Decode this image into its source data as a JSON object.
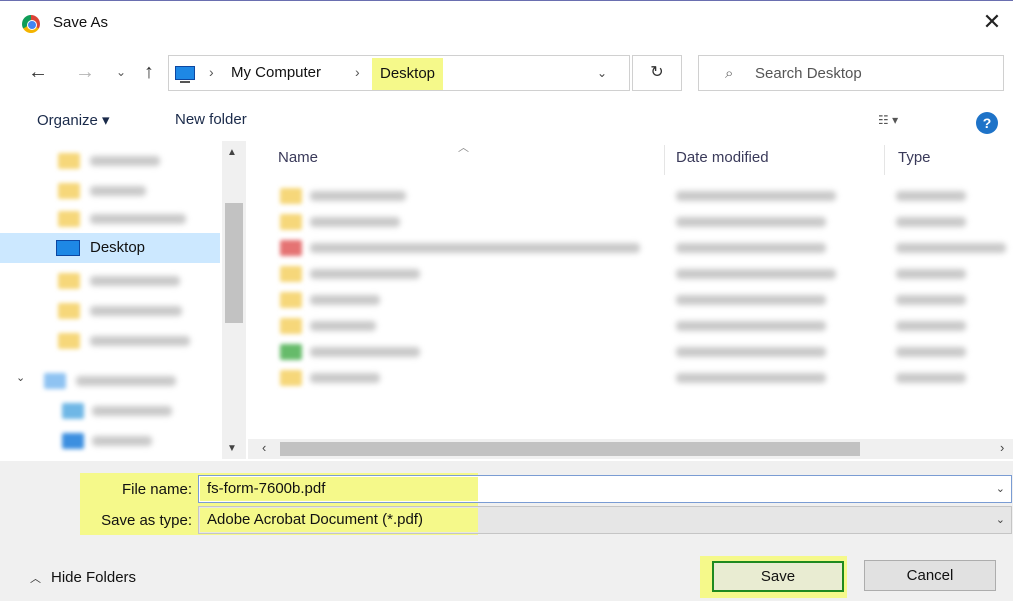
{
  "window": {
    "title": "Save As",
    "close_glyph": "✕"
  },
  "nav": {
    "back_glyph": "←",
    "forward_glyph": "→",
    "recent_glyph": "⌄",
    "up_glyph": "↑",
    "breadcrumb": [
      "My Computer",
      "Desktop"
    ],
    "separator": "›",
    "dropdown_glyph": "⌄",
    "refresh_glyph": "↻",
    "search_placeholder": "Search Desktop",
    "search_glyph": "⌕"
  },
  "toolbar": {
    "organize_label": "Organize ▾",
    "new_folder_label": "New folder",
    "view_glyph": "☷ ▾",
    "help_glyph": "?"
  },
  "nav_pane": {
    "selected_label": "Desktop",
    "expand_glyph": "⌄"
  },
  "file_list": {
    "columns": [
      "Name",
      "Date modified",
      "Type"
    ],
    "sort_glyph": "︿"
  },
  "scroll": {
    "up_glyph": "▲",
    "down_glyph": "▼",
    "left_glyph": "‹",
    "right_glyph": "›"
  },
  "form": {
    "file_name_label": "File name:",
    "file_name_value": "fs-form-7600b.pdf",
    "save_type_label": "Save as type:",
    "save_type_value": "Adobe Acrobat Document (*.pdf)",
    "caret_glyph": "⌄"
  },
  "footer": {
    "hide_folders_label": "Hide Folders",
    "hide_caret": "︿",
    "save_label": "Save",
    "cancel_label": "Cancel"
  },
  "colors": {
    "highlight": "#f5f98a",
    "selection": "#cce8ff",
    "save_border": "#1f8a1f"
  }
}
